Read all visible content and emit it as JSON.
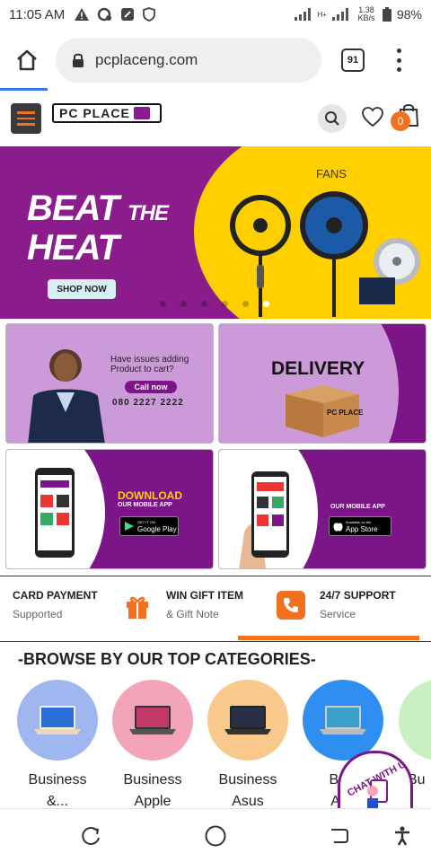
{
  "status": {
    "time": "11:05 AM",
    "network": "H+",
    "speed_value": "1.38",
    "speed_unit": "KB/s",
    "battery": "98%"
  },
  "browser": {
    "url": "pcplaceng.com",
    "tab_count": "91",
    "load_progress": 0.11
  },
  "header": {
    "logo_text": "PC PLACE",
    "cart_count": "0"
  },
  "hero": {
    "headline_1": "BEAT",
    "headline_the": "THE",
    "headline_2": "HEAT",
    "button": "SHOP NOW",
    "tag": "FANS",
    "slide_count": 6,
    "active_slide": 6
  },
  "promos": {
    "support": {
      "line1": "Have issues adding",
      "line2": "Product to cart?",
      "button": "Call now",
      "phone": "080 2227 2222"
    },
    "delivery": {
      "title": "DELIVERY",
      "box_label": "PC PLACE"
    },
    "download": {
      "title": "DOWNLOAD",
      "subtitle": "OUR MOBILE APP",
      "store_small": "GET IT ON",
      "store": "Google Play"
    },
    "appstore": {
      "subtitle": "OUR MOBILE APP",
      "store_small": "Available on the",
      "store": "App Store"
    }
  },
  "features": [
    {
      "title": "CARD PAYMENT",
      "subtitle": "Supported"
    },
    {
      "title": "WIN GIFT ITEM",
      "subtitle": "& Gift Note"
    },
    {
      "title": "24/7 SUPPORT",
      "subtitle": "Service"
    }
  ],
  "categories_title": "-BROWSE BY OUR TOP CATEGORIES-",
  "categories": [
    {
      "line1": "Business",
      "line2": "&...",
      "color": "#9fb6f0"
    },
    {
      "line1": "Business",
      "line2": "Apple",
      "color": "#f4a4b8"
    },
    {
      "line1": "Business",
      "line2": "Asus",
      "color": "#f8c98a"
    },
    {
      "line1": "Busi",
      "line2": "Asu",
      "color": "#2f8ff0"
    },
    {
      "line1": "Bu",
      "line2": "",
      "color": "#c8f0c0"
    }
  ],
  "chat_label": "CHAT WITH US",
  "colors": {
    "brand_purple": "#7c1587",
    "accent_orange": "#f37021",
    "hero_yellow": "#ffcf00"
  }
}
